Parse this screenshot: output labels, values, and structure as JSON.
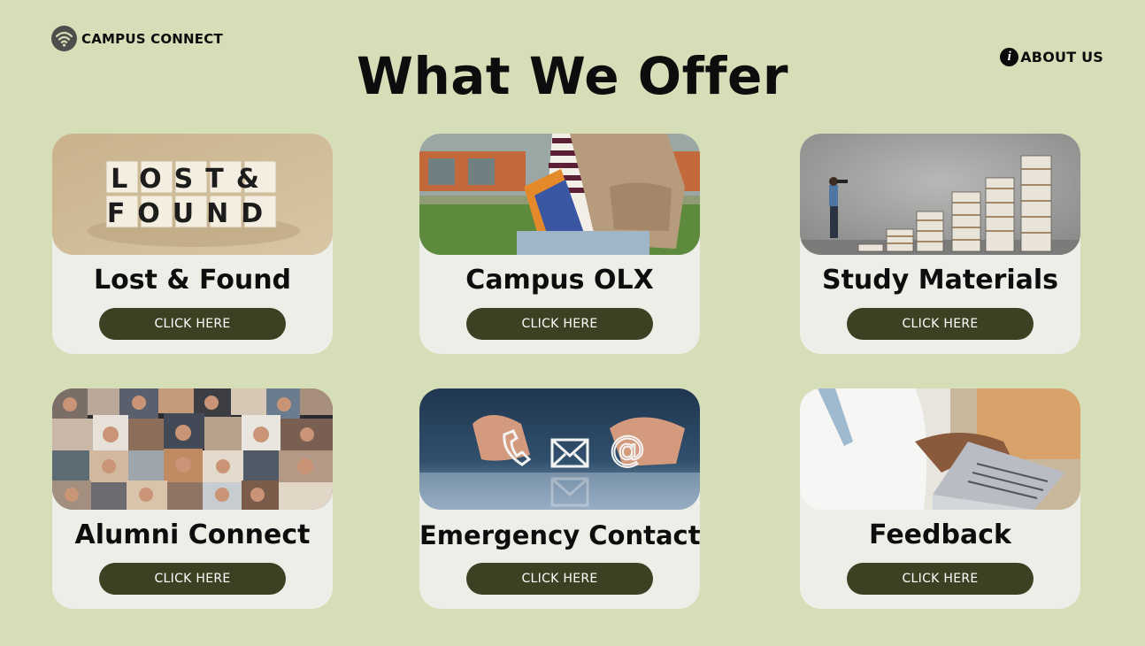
{
  "brand": {
    "name": "CAMPUS CONNECT",
    "logo_icon": "wifi-icon"
  },
  "nav": {
    "about_label": "ABOUT US",
    "about_icon": "info-icon"
  },
  "page": {
    "title": "What We Offer"
  },
  "colors": {
    "background": "#d6deb7",
    "card": "#eeeee9",
    "button": "#3d4123",
    "button_text": "#ffffff"
  },
  "cards": [
    {
      "title": "Lost & Found",
      "button": "CLICK HERE",
      "image_text": [
        "LOST&",
        "FOUND"
      ]
    },
    {
      "title": "Campus OLX",
      "button": "CLICK HERE"
    },
    {
      "title": "Study Materials",
      "button": "CLICK HERE"
    },
    {
      "title": "Alumni Connect",
      "button": "CLICK HERE"
    },
    {
      "title": "Emergency Contact",
      "button": "CLICK HERE"
    },
    {
      "title": "Feedback",
      "button": "CLICK HERE"
    }
  ]
}
